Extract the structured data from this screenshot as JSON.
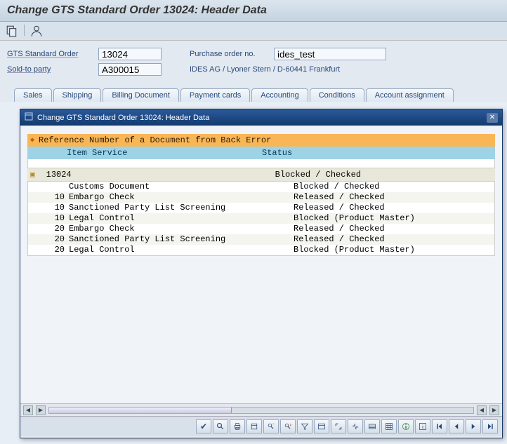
{
  "page_title": "Change GTS Standard Order 13024: Header Data",
  "form": {
    "order_label": "GTS Standard Order",
    "order_value": "13024",
    "po_label": "Purchase order no.",
    "po_value": "ides_test",
    "soldto_label": "Sold-to party",
    "soldto_value": "A300015",
    "soldto_text": "IDES AG / Lyoner Stern / D-60441 Frankfurt"
  },
  "tabs": [
    "Sales",
    "Shipping",
    "Billing Document",
    "Payment cards",
    "Accounting",
    "Conditions",
    "Account assignment"
  ],
  "modal": {
    "title": "Change GTS Standard Order 13024: Header Data",
    "ref_header": "Reference Number of a Document from Back Error",
    "col_itemservice": "Item Service",
    "col_status": "Status",
    "group_id": "13024",
    "group_status": "Blocked / Checked",
    "rows": [
      {
        "item": "",
        "service": "Customs Document",
        "status": "Blocked / Checked"
      },
      {
        "item": "10",
        "service": "Embargo Check",
        "status": "Released / Checked"
      },
      {
        "item": "10",
        "service": "Sanctioned Party List Screening",
        "status": "Released / Checked"
      },
      {
        "item": "10",
        "service": "Legal Control",
        "status": "Blocked (Product Master)"
      },
      {
        "item": "20",
        "service": "Embargo Check",
        "status": "Released / Checked"
      },
      {
        "item": "20",
        "service": "Sanctioned Party List Screening",
        "status": "Released / Checked"
      },
      {
        "item": "20",
        "service": "Legal Control",
        "status": "Blocked (Product Master)"
      }
    ]
  },
  "footer_icons": [
    "check-icon",
    "search-icon",
    "print-icon",
    "download-icon",
    "find-icon",
    "find-next-icon",
    "filter-icon",
    "sum-icon",
    "expand-icon",
    "collapse-icon",
    "layout-icon",
    "grid-icon",
    "info-icon",
    "help-icon",
    "first-icon",
    "prev-icon",
    "next-icon",
    "last-icon"
  ]
}
